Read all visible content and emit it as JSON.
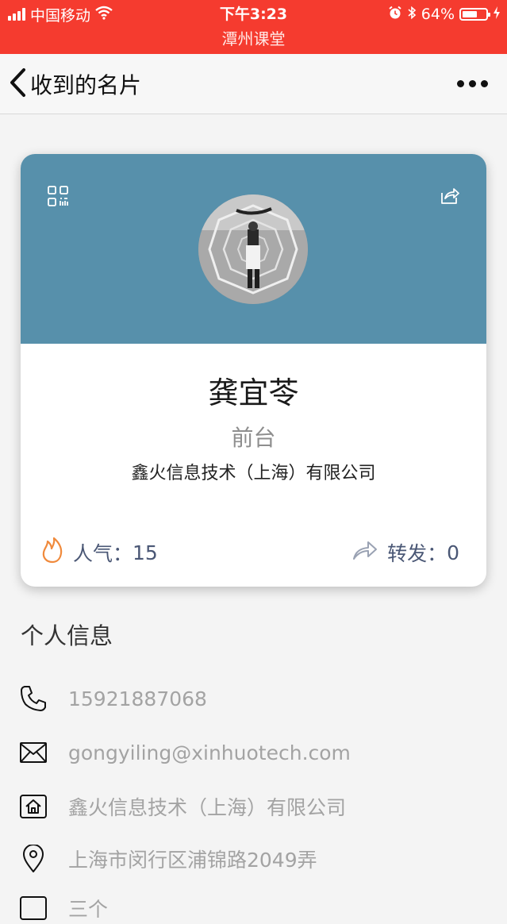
{
  "status_bar": {
    "carrier": "中国移动",
    "time": "下午3:23",
    "battery": "64%",
    "battery_level": 0.64,
    "app_name": "潭州课堂"
  },
  "nav": {
    "title": "收到的名片"
  },
  "card": {
    "name": "龚宜苓",
    "position": "前台",
    "company": "鑫火信息技术（上海）有限公司",
    "popularity_label": "人气：",
    "popularity_value": "15",
    "forward_label": "转发：",
    "forward_value": "0"
  },
  "info": {
    "title": "个人信息",
    "phone": "15921887068",
    "email": "gongyiling@xinhuotech.com",
    "company": "鑫火信息技术（上海）有限公司",
    "address": "上海市闵行区浦锦路2049弄",
    "partial": "三个"
  },
  "colors": {
    "status_red": "#f53b2f",
    "card_header": "#5790ab",
    "stat_text": "#4a5775",
    "flame": "#f08a3c"
  }
}
